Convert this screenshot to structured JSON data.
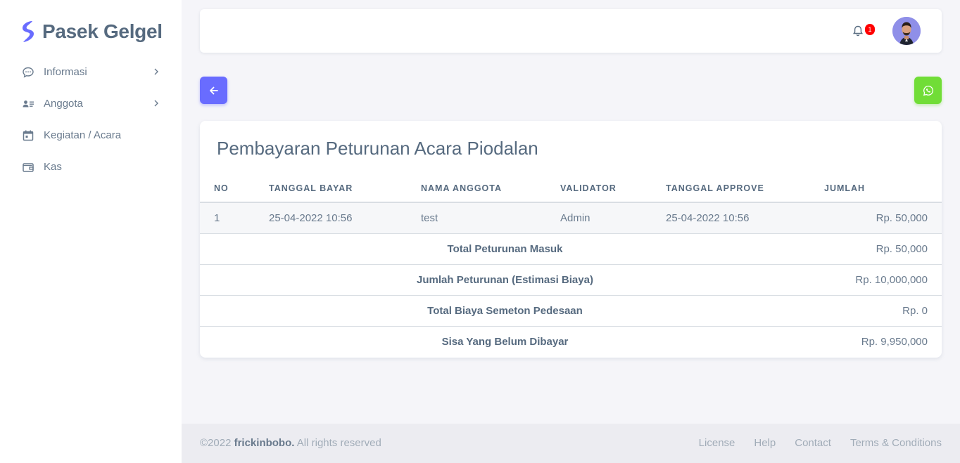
{
  "brand": {
    "name": "Pasek Gelgel",
    "accent": "#696cff"
  },
  "sidebar": {
    "items": [
      {
        "label": "Informasi",
        "icon": "chat-bubble-icon",
        "has_submenu": true
      },
      {
        "label": "Anggota",
        "icon": "user-list-icon",
        "has_submenu": true
      },
      {
        "label": "Kegiatan / Acara",
        "icon": "calendar-icon",
        "has_submenu": false
      },
      {
        "label": "Kas",
        "icon": "wallet-icon",
        "has_submenu": false
      }
    ]
  },
  "navbar": {
    "notification_count": "1",
    "bell_icon": "bell-icon",
    "avatar_icon": "user-avatar"
  },
  "actions": {
    "back_icon": "arrow-left-icon",
    "whatsapp_icon": "whatsapp-icon",
    "whatsapp_color": "#71dd37"
  },
  "card": {
    "title": "Pembayaran Peturunan Acara Piodalan",
    "columns": [
      "NO",
      "TANGGAL BAYAR",
      "NAMA ANGGOTA",
      "VALIDATOR",
      "TANGGAL APPROVE",
      "JUMLAH"
    ],
    "rows": [
      {
        "no": "1",
        "tanggal_bayar": "25-04-2022 10:56",
        "nama_anggota": "test",
        "validator": "Admin",
        "tanggal_approve": "25-04-2022 10:56",
        "jumlah": "Rp. 50,000"
      }
    ],
    "summary": [
      {
        "label": "Total Peturunan Masuk",
        "value": "Rp. 50,000"
      },
      {
        "label": "Jumlah Peturunan (Estimasi Biaya)",
        "value": "Rp. 10,000,000"
      },
      {
        "label": "Total Biaya Semeton Pedesaan",
        "value": "Rp. 0"
      },
      {
        "label": "Sisa Yang Belum Dibayar",
        "value": "Rp. 9,950,000"
      }
    ]
  },
  "footer": {
    "copyright_prefix": "©2022 ",
    "copyright_name": "frickinbobo.",
    "copyright_suffix": " All rights reserved",
    "links": [
      "License",
      "Help",
      "Contact",
      "Terms & Conditions"
    ]
  }
}
